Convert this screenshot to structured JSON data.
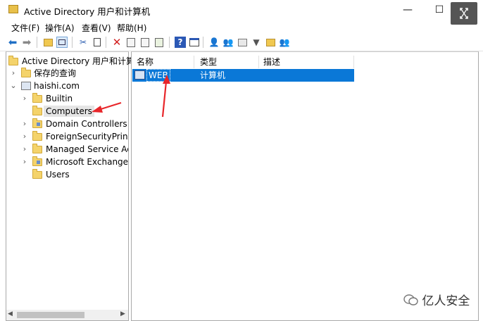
{
  "window": {
    "title": "Active Directory 用户和计算机",
    "minimize": "—",
    "maximize": "☐",
    "close": "✕"
  },
  "menu": [
    "文件(F)",
    "操作(A)",
    "查看(V)",
    "帮助(H)"
  ],
  "toolbar_icons": [
    "back-arrow-icon",
    "forward-arrow-icon",
    "up-folder-icon",
    "show-pane-icon",
    "cut-icon",
    "copy-icon",
    "delete-icon",
    "properties-icon",
    "refresh-icon",
    "export-icon",
    "help-icon",
    "console-icon",
    "add-user-icon",
    "add-group-icon",
    "add-ou-icon",
    "filter-icon",
    "find-icon",
    "add-to-group-icon"
  ],
  "tree": {
    "root": "Active Directory 用户和计算机",
    "saved_queries": "保存的查询",
    "domain": "haishi.com",
    "items": [
      "Builtin",
      "Computers",
      "Domain Controllers",
      "ForeignSecurityPrincipals",
      "Managed Service Accounts",
      "Microsoft Exchange Security Groups",
      "Users"
    ]
  },
  "list": {
    "columns": [
      "名称",
      "类型",
      "描述"
    ],
    "rows": [
      {
        "name": "WEB",
        "type": "计算机",
        "desc": ""
      }
    ]
  },
  "watermark": "亿人安全",
  "colors": {
    "selection": "#0a78d7",
    "annotation": "#e8262a"
  }
}
